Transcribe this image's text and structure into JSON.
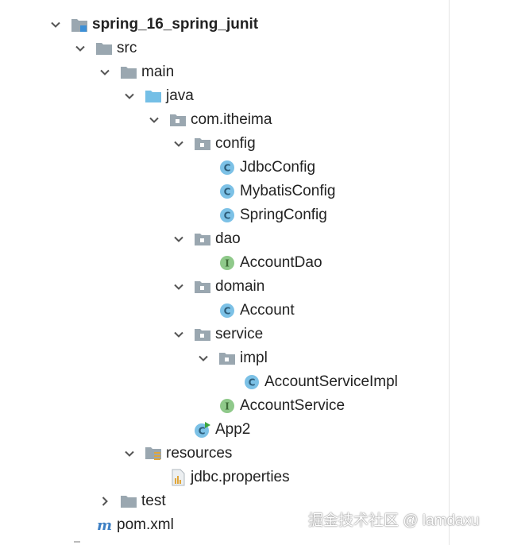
{
  "tree": {
    "items": [
      {
        "label": "spring_16_spring_junit",
        "depth": 0,
        "expanded": true,
        "has_arrow": true,
        "icon": "module-folder-icon",
        "bold": true
      },
      {
        "label": "src",
        "depth": 1,
        "expanded": true,
        "has_arrow": true,
        "icon": "folder-icon"
      },
      {
        "label": "main",
        "depth": 2,
        "expanded": true,
        "has_arrow": true,
        "icon": "folder-icon"
      },
      {
        "label": "java",
        "depth": 3,
        "expanded": true,
        "has_arrow": true,
        "icon": "source-folder-icon"
      },
      {
        "label": "com.itheima",
        "depth": 4,
        "expanded": true,
        "has_arrow": true,
        "icon": "package-icon"
      },
      {
        "label": "config",
        "depth": 5,
        "expanded": true,
        "has_arrow": true,
        "icon": "package-icon"
      },
      {
        "label": "JdbcConfig",
        "depth": 6,
        "has_arrow": false,
        "icon": "class-icon"
      },
      {
        "label": "MybatisConfig",
        "depth": 6,
        "has_arrow": false,
        "icon": "class-icon"
      },
      {
        "label": "SpringConfig",
        "depth": 6,
        "has_arrow": false,
        "icon": "class-icon"
      },
      {
        "label": "dao",
        "depth": 5,
        "expanded": true,
        "has_arrow": true,
        "icon": "package-icon"
      },
      {
        "label": "AccountDao",
        "depth": 6,
        "has_arrow": false,
        "icon": "interface-icon"
      },
      {
        "label": "domain",
        "depth": 5,
        "expanded": true,
        "has_arrow": true,
        "icon": "package-icon"
      },
      {
        "label": "Account",
        "depth": 6,
        "has_arrow": false,
        "icon": "class-icon"
      },
      {
        "label": "service",
        "depth": 5,
        "expanded": true,
        "has_arrow": true,
        "icon": "package-icon"
      },
      {
        "label": "impl",
        "depth": 6,
        "expanded": true,
        "has_arrow": true,
        "icon": "package-icon"
      },
      {
        "label": "AccountServiceImpl",
        "depth": 7,
        "has_arrow": false,
        "icon": "class-icon"
      },
      {
        "label": "AccountService",
        "depth": 6,
        "has_arrow": false,
        "icon": "interface-icon"
      },
      {
        "label": "App2",
        "depth": 5,
        "has_arrow": false,
        "icon": "runnable-class-icon"
      },
      {
        "label": "resources",
        "depth": 3,
        "expanded": true,
        "has_arrow": true,
        "icon": "resources-folder-icon"
      },
      {
        "label": "jdbc.properties",
        "depth": 4,
        "has_arrow": false,
        "icon": "properties-file-icon"
      },
      {
        "label": "test",
        "depth": 2,
        "expanded": false,
        "has_arrow": true,
        "icon": "folder-icon"
      },
      {
        "label": "pom.xml",
        "depth": 1,
        "has_arrow": false,
        "icon": "maven-icon"
      }
    ]
  },
  "watermark": {
    "text": "掘金技术社区 @ lamdaxu"
  },
  "colors": {
    "folder": "#9aa7b0",
    "source_folder": "#74bfe6",
    "class_badge": "#7cc1e6",
    "interface_badge": "#8fc98a",
    "arrow": "#555555"
  }
}
